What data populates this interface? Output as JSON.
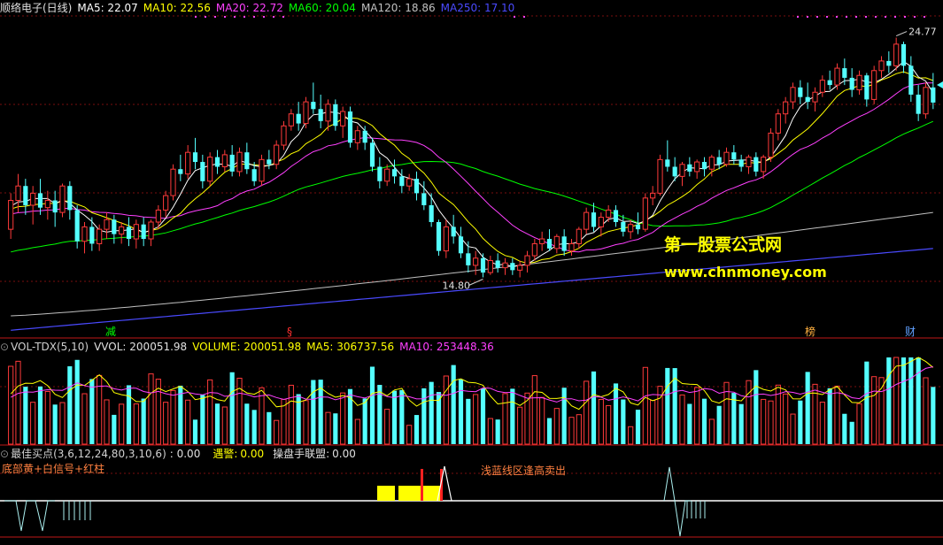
{
  "main_panel": {
    "stock_name": "顺络电子(日线)",
    "ma_labels": [
      {
        "text": "MA5: 22.07",
        "color": "#ffffff"
      },
      {
        "text": "MA10: 22.56",
        "color": "#ffff00"
      },
      {
        "text": "MA20: 22.72",
        "color": "#ff40ff"
      },
      {
        "text": "MA60: 20.04",
        "color": "#00ff00"
      },
      {
        "text": "MA120: 18.86",
        "color": "#c0c0c0"
      },
      {
        "text": "MA250: 17.10",
        "color": "#4a4aff"
      }
    ],
    "high_label": "24.77",
    "low_label": "14.80",
    "markers": [
      {
        "text": "减",
        "color": "#00ff00"
      },
      {
        "text": "§",
        "color": "#ff3030"
      },
      {
        "text": "榜",
        "color": "#ffb040"
      },
      {
        "text": "财",
        "color": "#60a0ff"
      }
    ]
  },
  "watermark": {
    "line1": "第一股票公式网",
    "line2": "www.chnmoney.com"
  },
  "volume_panel": {
    "title": "VOL-TDX(5,10)",
    "vvol": "VVOL: 200051.98",
    "volume": "VOLUME: 200051.98",
    "ma5": "MA5: 306737.56",
    "ma10": "MA10: 253448.36"
  },
  "indicator_panel": {
    "title": "最佳买点(3,6,12,24,80,3,10,6)",
    "value": ": 0.00",
    "alert_label": "遇警:",
    "alert_value": "0.00",
    "union_label": "操盘手联盟:",
    "union_value": "0.00",
    "note_left": "底部黄+白信号+红柱",
    "note_mid": "浅蓝线区逢高卖出"
  },
  "colors": {
    "up": "#ff3a3a",
    "down": "#54ffff",
    "border": "#c01818"
  },
  "chart_data": {
    "type": "candlestick",
    "ohlc_approx": [
      [
        16.8,
        18.3,
        16.4,
        18.0
      ],
      [
        18.0,
        19.1,
        17.5,
        18.6
      ],
      [
        18.6,
        18.9,
        17.4,
        17.8
      ],
      [
        17.8,
        18.6,
        17.0,
        18.3
      ],
      [
        18.3,
        18.9,
        17.4,
        17.7
      ],
      [
        17.7,
        18.4,
        17.2,
        18.0
      ],
      [
        18.0,
        18.4,
        16.9,
        17.5
      ],
      [
        17.5,
        18.7,
        17.3,
        18.6
      ],
      [
        18.6,
        18.8,
        17.2,
        17.6
      ],
      [
        17.6,
        17.8,
        16.0,
        16.3
      ],
      [
        16.3,
        17.1,
        15.8,
        16.9
      ],
      [
        16.9,
        17.3,
        15.9,
        16.2
      ],
      [
        16.2,
        17.0,
        15.9,
        16.8
      ],
      [
        16.8,
        17.5,
        16.4,
        17.2
      ],
      [
        17.2,
        17.4,
        16.2,
        16.6
      ],
      [
        16.6,
        17.1,
        16.2,
        16.9
      ],
      [
        16.9,
        17.3,
        16.1,
        16.4
      ],
      [
        16.4,
        17.2,
        16.0,
        17.0
      ],
      [
        17.0,
        17.3,
        16.1,
        16.4
      ],
      [
        16.4,
        17.2,
        16.1,
        17.1
      ],
      [
        17.1,
        17.8,
        16.8,
        17.6
      ],
      [
        17.6,
        18.4,
        17.3,
        18.2
      ],
      [
        18.2,
        19.5,
        18.0,
        19.3
      ],
      [
        19.3,
        19.9,
        18.8,
        19.1
      ],
      [
        19.1,
        20.3,
        18.9,
        20.0
      ],
      [
        20.0,
        20.6,
        19.3,
        19.6
      ],
      [
        19.6,
        19.9,
        18.5,
        18.8
      ],
      [
        18.8,
        20.0,
        18.6,
        19.8
      ],
      [
        19.8,
        20.1,
        19.1,
        19.4
      ],
      [
        19.4,
        20.1,
        19.2,
        19.9
      ],
      [
        19.9,
        20.3,
        19.0,
        19.2
      ],
      [
        19.2,
        20.2,
        19.0,
        20.0
      ],
      [
        20.0,
        20.4,
        19.1,
        19.3
      ],
      [
        19.3,
        19.6,
        18.6,
        18.8
      ],
      [
        18.8,
        19.9,
        18.6,
        19.7
      ],
      [
        19.7,
        20.1,
        19.3,
        19.5
      ],
      [
        19.5,
        20.5,
        19.3,
        20.3
      ],
      [
        20.3,
        21.3,
        20.1,
        21.1
      ],
      [
        21.1,
        21.8,
        20.9,
        21.6
      ],
      [
        21.6,
        22.1,
        20.9,
        21.2
      ],
      [
        21.2,
        22.3,
        21.0,
        22.1
      ],
      [
        22.1,
        22.9,
        21.6,
        21.8
      ],
      [
        21.8,
        22.4,
        21.0,
        21.3
      ],
      [
        21.3,
        22.2,
        20.9,
        22.0
      ],
      [
        22.0,
        22.2,
        20.9,
        21.1
      ],
      [
        21.1,
        21.9,
        20.6,
        21.7
      ],
      [
        21.7,
        21.9,
        20.2,
        20.4
      ],
      [
        20.4,
        21.1,
        20.1,
        20.9
      ],
      [
        20.9,
        21.1,
        20.1,
        20.4
      ],
      [
        20.4,
        20.6,
        19.2,
        19.4
      ],
      [
        19.4,
        19.8,
        18.5,
        18.8
      ],
      [
        18.8,
        19.5,
        18.6,
        19.3
      ],
      [
        19.3,
        19.7,
        18.7,
        19.0
      ],
      [
        19.0,
        19.3,
        18.3,
        18.6
      ],
      [
        18.6,
        19.1,
        18.4,
        18.9
      ],
      [
        18.9,
        19.2,
        18.0,
        18.3
      ],
      [
        18.3,
        18.8,
        17.6,
        17.8
      ],
      [
        17.8,
        18.3,
        16.9,
        17.1
      ],
      [
        17.1,
        17.2,
        15.7,
        15.9
      ],
      [
        15.9,
        17.2,
        15.6,
        16.9
      ],
      [
        16.9,
        17.4,
        16.2,
        16.5
      ],
      [
        16.5,
        16.9,
        15.6,
        15.8
      ],
      [
        15.8,
        16.3,
        15.0,
        15.3
      ],
      [
        15.3,
        15.9,
        14.9,
        15.6
      ],
      [
        15.6,
        15.8,
        14.8,
        15.0
      ],
      [
        15.0,
        15.7,
        14.9,
        15.5
      ],
      [
        15.5,
        15.8,
        15.0,
        15.2
      ],
      [
        15.2,
        15.6,
        14.9,
        15.4
      ],
      [
        15.4,
        15.6,
        14.9,
        15.1
      ],
      [
        15.1,
        15.5,
        14.8,
        15.3
      ],
      [
        15.3,
        15.9,
        15.0,
        15.7
      ],
      [
        15.7,
        16.4,
        15.5,
        16.2
      ],
      [
        16.2,
        16.7,
        15.9,
        16.4
      ],
      [
        16.4,
        16.8,
        15.9,
        16.0
      ],
      [
        16.0,
        16.6,
        15.8,
        16.5
      ],
      [
        16.5,
        16.8,
        15.7,
        15.9
      ],
      [
        15.9,
        16.4,
        15.7,
        16.2
      ],
      [
        16.2,
        16.9,
        16.0,
        16.8
      ],
      [
        16.8,
        17.7,
        16.6,
        17.5
      ],
      [
        17.5,
        17.9,
        16.7,
        16.9
      ],
      [
        16.9,
        17.5,
        16.5,
        17.3
      ],
      [
        17.3,
        17.8,
        17.1,
        17.6
      ],
      [
        17.6,
        17.8,
        16.9,
        17.1
      ],
      [
        17.1,
        17.4,
        16.5,
        16.7
      ],
      [
        16.7,
        17.2,
        16.4,
        17.0
      ],
      [
        17.0,
        17.5,
        16.6,
        16.8
      ],
      [
        16.8,
        18.3,
        16.7,
        18.1
      ],
      [
        18.1,
        18.6,
        17.8,
        18.3
      ],
      [
        18.3,
        19.9,
        18.2,
        19.7
      ],
      [
        19.7,
        20.5,
        19.2,
        19.4
      ],
      [
        19.4,
        19.8,
        18.8,
        19.0
      ],
      [
        19.0,
        19.6,
        18.6,
        19.5
      ],
      [
        19.5,
        19.8,
        19.0,
        19.2
      ],
      [
        19.2,
        19.7,
        18.9,
        19.6
      ],
      [
        19.6,
        19.8,
        19.0,
        19.3
      ],
      [
        19.3,
        19.9,
        19.0,
        19.8
      ],
      [
        19.8,
        20.1,
        19.3,
        19.5
      ],
      [
        19.5,
        20.2,
        19.4,
        20.0
      ],
      [
        20.0,
        20.3,
        19.5,
        19.7
      ],
      [
        19.7,
        19.9,
        19.2,
        19.4
      ],
      [
        19.4,
        19.9,
        19.1,
        19.8
      ],
      [
        19.8,
        20.0,
        19.0,
        19.2
      ],
      [
        19.2,
        19.9,
        18.9,
        19.8
      ],
      [
        19.8,
        21.0,
        19.6,
        20.8
      ],
      [
        20.8,
        21.8,
        20.5,
        21.6
      ],
      [
        21.6,
        22.3,
        21.2,
        22.1
      ],
      [
        22.1,
        22.9,
        21.8,
        22.7
      ],
      [
        22.7,
        23.0,
        22.0,
        22.3
      ],
      [
        22.3,
        22.9,
        21.8,
        22.1
      ],
      [
        22.1,
        22.7,
        21.7,
        22.5
      ],
      [
        22.5,
        23.2,
        22.3,
        23.0
      ],
      [
        23.0,
        23.4,
        22.6,
        22.8
      ],
      [
        22.8,
        23.7,
        22.6,
        23.5
      ],
      [
        23.5,
        23.9,
        22.8,
        23.1
      ],
      [
        23.1,
        23.5,
        22.3,
        22.6
      ],
      [
        22.6,
        23.4,
        22.4,
        23.2
      ],
      [
        23.2,
        23.3,
        21.9,
        22.2
      ],
      [
        22.2,
        23.6,
        22.0,
        23.4
      ],
      [
        23.4,
        24.0,
        23.1,
        23.8
      ],
      [
        23.8,
        24.2,
        23.3,
        23.6
      ],
      [
        23.6,
        24.77,
        23.4,
        24.5
      ],
      [
        24.5,
        24.6,
        23.3,
        23.6
      ],
      [
        23.6,
        24.0,
        22.1,
        22.4
      ],
      [
        22.4,
        22.8,
        21.3,
        21.6
      ],
      [
        21.6,
        22.9,
        21.4,
        22.7
      ],
      [
        22.7,
        23.3,
        21.8,
        22.07
      ]
    ]
  }
}
